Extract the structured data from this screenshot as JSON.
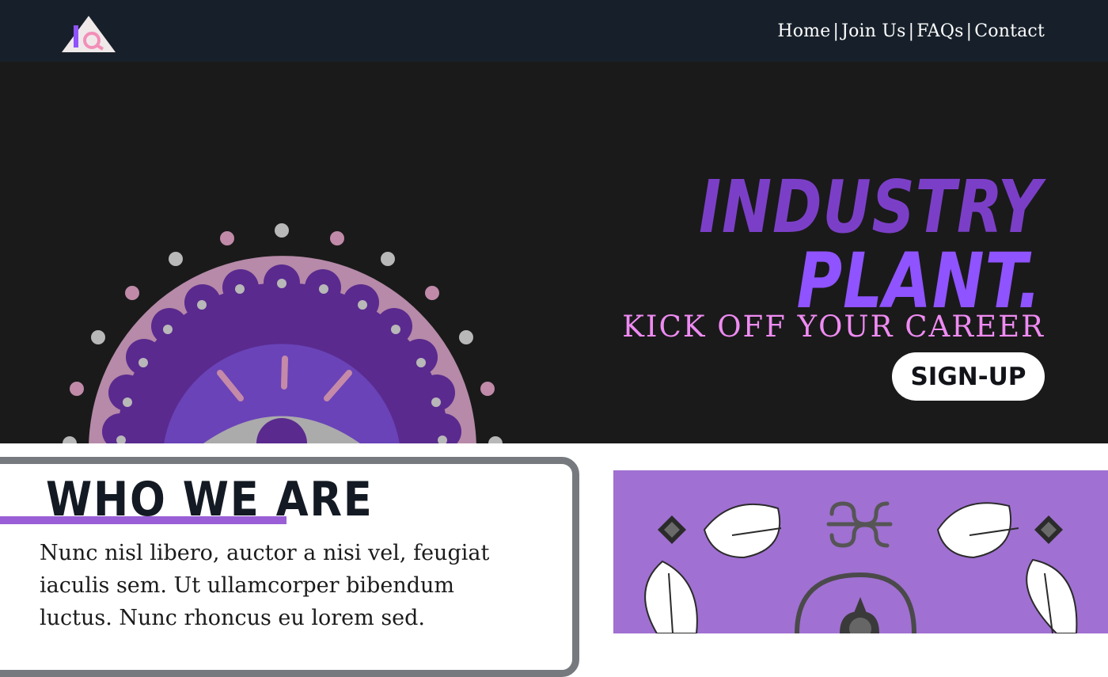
{
  "colors": {
    "topbar": "#17202a",
    "hero_bg": "#1a1a1a",
    "title_purple": "#7b3fc7",
    "title_violet": "#8f53ff",
    "tagline_pink": "#ef8bf2",
    "accent_lavender": "#a070d2",
    "card_border": "#767a7f"
  },
  "header": {
    "logo_icon": "pyramid-logo-icon",
    "nav": [
      {
        "label": "Home"
      },
      {
        "label": "Join Us"
      },
      {
        "label": "FAQs"
      },
      {
        "label": "Contact"
      }
    ],
    "separator": "|"
  },
  "hero": {
    "title_line1": "Industry",
    "title_line2": "Plant.",
    "tagline": "KICK OFF YOUR CAREER",
    "signup_label": "Sign-up",
    "illustration_icon": "mandala-eye-icon"
  },
  "about": {
    "heading": "Who We Are",
    "body": "Nunc nisl libero, auctor a nisi vel, feugiat iaculis sem. Ut ullamcorper bibendum luctus. Nunc rhoncus eu lorem sed."
  },
  "art_panel": {
    "icons": [
      "monstera-leaf-icon",
      "diamond-icon",
      "ornament-icon",
      "arch-icon"
    ]
  }
}
